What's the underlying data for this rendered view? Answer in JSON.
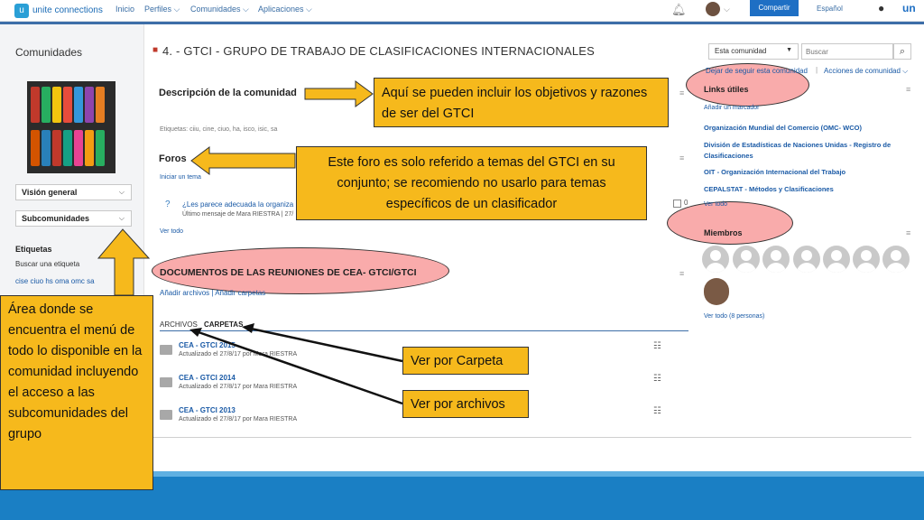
{
  "topnav": {
    "brand": "unite connections",
    "links": [
      "Inicio",
      "Perfiles ⌵",
      "Comunidades ⌵",
      "Aplicaciones ⌵"
    ],
    "share_label": "Compartir",
    "language": "Español"
  },
  "sidebar": {
    "title": "Comunidades",
    "vision_general": "Visión general",
    "subcomunidades": "Subcomunidades",
    "tags_title": "Etiquetas",
    "search_tag": "Buscar una etiqueta",
    "tags": "cise  ciuo  hs  oma  omc  sa"
  },
  "main": {
    "title": "4. - GTCI - GRUPO DE TRABAJO DE CLASIFICACIONES INTERNACIONALES",
    "description_heading": "Descripción de la comunidad",
    "tags_line": "Etiquetas: ciiu, cine, ciuo, ha, isco, isic, sa",
    "foros_heading": "Foros",
    "start_topic": "Iniciar un tema",
    "post_title": "¿Les parece adecuada la organiza",
    "post_sub": "Último mensaje de Mara RIESTRA  |  27/",
    "post_count": "0",
    "view_all": "Ver todo",
    "documents_heading": "DOCUMENTOS DE LAS REUNIONES DE CEA- GTCI/GTCI",
    "add_files": "Añadir archivos  |  Añadir carpetas",
    "tab_files": "ARCHIVOS",
    "tab_folders": "CARPETAS",
    "folders": [
      {
        "name": "CEA - GTCI 2015",
        "sub": "Actualizado el 27/8/17 por Mara RIESTRA"
      },
      {
        "name": "CEA - GTCI 2014",
        "sub": "Actualizado el 27/8/17 por Mara RIESTRA"
      },
      {
        "name": "CEA - GTCI 2013",
        "sub": "Actualizado el 27/8/17 por Mara RIESTRA"
      }
    ]
  },
  "right": {
    "scope": "Esta comunidad",
    "search_placeholder": "Buscar",
    "unfollow": "Dejar de seguir esta comunidad",
    "actions": "Acciones de comunidad ⌵",
    "links_title": "Links útiles",
    "add_marker": "Añadir un marcador",
    "links": [
      "Organización Mundial del Comercio (OMC- WCO)",
      "División de Estadísticas de Naciones Unidas - Registro de Clasificaciones",
      "OIT - Organización Internacional del Trabajo",
      "CEPALSTAT - Métodos y Clasificaciones"
    ],
    "view_all_links": "Ver todo",
    "members_title": "Miembros",
    "view_all_members": "Ver todo (8 personas)"
  },
  "annotations": {
    "left": "Área donde se encuentra el menú de todo lo disponible en la comunidad incluyendo el acceso a las subcomunidades del grupo",
    "description": "Aquí se pueden incluir los objetivos y razones de ser del GTCI",
    "foro": "Este foro es solo referido a temas del GTCI en su conjunto; se recomiendo no usarlo para temas específicos de un clasificador",
    "carpeta": "Ver por Carpeta",
    "archivos": "Ver por archivos"
  },
  "colors": {
    "accent_blue": "#1e6fc4",
    "callout_orange": "#f6b91c",
    "highlight_red": "#f79494"
  }
}
